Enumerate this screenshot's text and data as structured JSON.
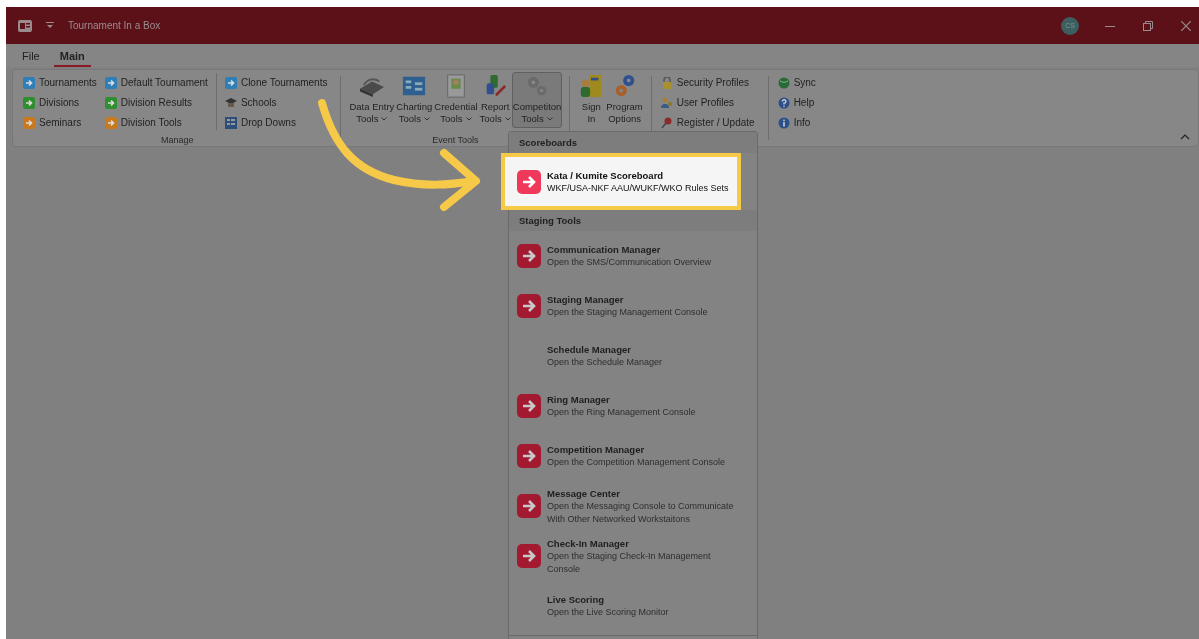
{
  "window": {
    "title": "Tournament In a Box",
    "user_initials": "CS"
  },
  "tabs": [
    {
      "label": "File",
      "selected": false
    },
    {
      "label": "Main",
      "selected": true
    }
  ],
  "ribbon": {
    "groups": [
      {
        "kind": "small",
        "label": "Manage",
        "columns": [
          [
            {
              "label": "Tournaments",
              "kind": "arrow",
              "color": "#2e7fb8"
            },
            {
              "label": "Divisions",
              "kind": "arrow",
              "color": "#2f8f2f"
            },
            {
              "label": "Seminars",
              "kind": "arrow",
              "color": "#c8781e"
            }
          ],
          [
            {
              "label": "Default Tournament",
              "kind": "arrow",
              "color": "#2e7fb8"
            },
            {
              "label": "Division Results",
              "kind": "arrow",
              "color": "#2f8f2f"
            },
            {
              "label": "Division Tools",
              "kind": "arrow",
              "color": "#c8781e"
            }
          ],
          [
            {
              "label": "Clone Tournaments",
              "kind": "arrow",
              "color": "#2e7fb8"
            },
            {
              "label": "Schools",
              "kind": "cap"
            },
            {
              "label": "Drop Downs",
              "kind": "grid"
            }
          ]
        ]
      },
      {
        "kind": "large",
        "label": "Event Tools",
        "buttons": [
          {
            "lines": [
              "Data Entry",
              "Tools"
            ],
            "kind": "keyboard",
            "menu": true,
            "selected": false
          },
          {
            "lines": [
              "Charting",
              "Tools"
            ],
            "kind": "chart",
            "menu": true,
            "selected": false
          },
          {
            "lines": [
              "Credential",
              "Tools"
            ],
            "kind": "badge",
            "menu": true,
            "selected": false
          },
          {
            "lines": [
              "Report",
              "Tools"
            ],
            "kind": "report",
            "menu": true,
            "selected": false
          },
          {
            "lines": [
              "Competiton",
              "Tools"
            ],
            "kind": "gears",
            "menu": true,
            "selected": true
          }
        ]
      },
      {
        "kind": "large",
        "buttons": [
          {
            "lines": [
              "Sign",
              "In"
            ],
            "kind": "door",
            "menu": false,
            "selected": false
          },
          {
            "lines": [
              "Program",
              "Options"
            ],
            "kind": "gear",
            "menu": false,
            "selected": false
          }
        ]
      },
      {
        "kind": "small",
        "columns": [
          [
            {
              "label": "Security Profiles",
              "kind": "lock"
            },
            {
              "label": "User Profiles",
              "kind": "users"
            },
            {
              "label": "Register / Update",
              "kind": "pin"
            }
          ]
        ]
      },
      {
        "kind": "small",
        "columns": [
          [
            {
              "label": "Sync",
              "kind": "globe"
            },
            {
              "label": "Help",
              "kind": "help"
            },
            {
              "label": "Info",
              "kind": "info"
            }
          ]
        ]
      }
    ]
  },
  "menu": {
    "sections": [
      {
        "title": "Scoreboards",
        "items": [
          {
            "title": "Kata / Kumite Scoreboard",
            "description": [
              "WKF/USA-NKF AAU/WUKF/WKO Rules Sets"
            ],
            "kind": "arrow",
            "highlighted": true
          }
        ]
      },
      {
        "title": "Staging Tools",
        "items": [
          {
            "title": "Communication Manager",
            "description": [
              "Open the SMS/Communication Overview"
            ],
            "kind": "arrow",
            "highlighted": false
          },
          {
            "title": "Staging Manager",
            "description": [
              "Open the Staging Management Console"
            ],
            "kind": "arrow",
            "highlighted": false
          },
          {
            "title": "Schedule Manager",
            "description": [
              "Open the Schedule Manager"
            ],
            "kind": "plain",
            "highlighted": false
          },
          {
            "title": "Ring Manager",
            "description": [
              "Open the Ring Management Console"
            ],
            "kind": "arrow",
            "highlighted": false
          },
          {
            "title": "Competition Manager",
            "description": [
              "Open the Competition Management Console"
            ],
            "kind": "arrow",
            "highlighted": false
          },
          {
            "title": "Message Center",
            "description": [
              "Open the Messaging Console to Communicate",
              "With Other Networked Workstaitons"
            ],
            "kind": "arrow",
            "highlighted": false
          },
          {
            "title": "Check-In Manager",
            "description": [
              "Open the Staging Check-In Management",
              "Console"
            ],
            "kind": "arrow",
            "highlighted": false
          },
          {
            "title": "Live Scoring",
            "description": [
              "Open the Live Scoring Monitor"
            ],
            "kind": "plain",
            "highlighted": false
          }
        ]
      }
    ]
  }
}
